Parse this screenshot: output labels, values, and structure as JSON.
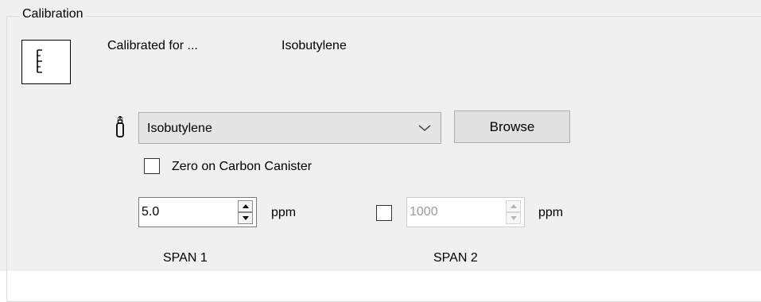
{
  "group": {
    "title": "Calibration"
  },
  "calibrated": {
    "label": "Calibrated for ...",
    "value": "Isobutylene"
  },
  "icons": {
    "calibration": "ruler-icon",
    "gas": "gas-cylinder-icon",
    "dropdown": "chevron-down-icon",
    "spin_up": "spin-up-arrow-icon",
    "spin_down": "spin-down-arrow-icon"
  },
  "gas_select": {
    "selected": "Isobutylene"
  },
  "browse": {
    "label": "Browse"
  },
  "zero_carbon": {
    "label": "Zero on Carbon Canister",
    "checked": false
  },
  "span1": {
    "value": "5.0",
    "unit": "ppm",
    "label": "SPAN 1"
  },
  "span2": {
    "enabled": false,
    "value": "1000",
    "unit": "ppm",
    "label": "SPAN 2"
  },
  "colors": {
    "panel_background": "#f0f0f0",
    "combo_background": "#e5e5e5",
    "button_background": "#e1e1e1",
    "disabled_text": "#9a9a9a"
  }
}
